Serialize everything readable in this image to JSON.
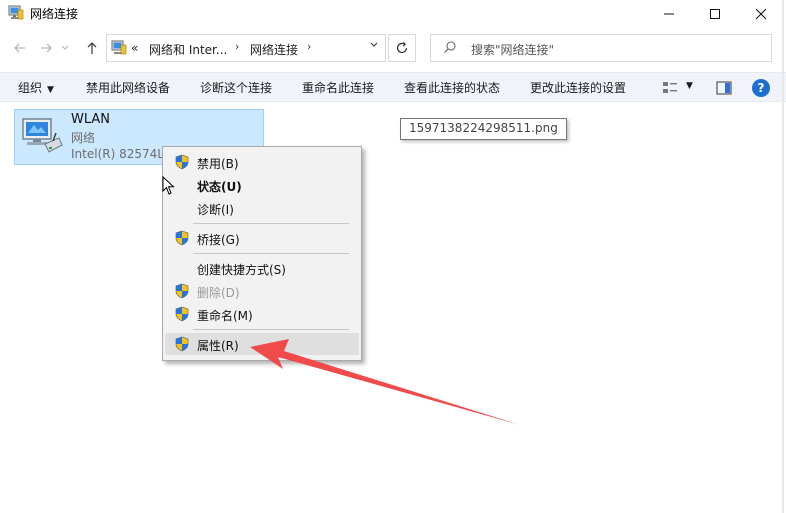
{
  "window": {
    "title": "网络连接",
    "minimize": "—",
    "maximize": "☐",
    "close": "✕"
  },
  "nav": {
    "back_icon": "arrow-left",
    "forward_icon": "arrow-right",
    "dropdown_icon": "chevron-down",
    "up_icon": "arrow-up",
    "breadcrumb_overflow": "«",
    "breadcrumbs": [
      "网络和 Inter...",
      "网络连接"
    ],
    "refresh_icon": "refresh",
    "search_placeholder": "搜索\"网络连接\""
  },
  "commands": {
    "organize": "组织",
    "disable_device": "禁用此网络设备",
    "diagnose": "诊断这个连接",
    "rename": "重命名此连接",
    "view_status": "查看此连接的状态",
    "change_settings": "更改此连接的设置",
    "help": "?"
  },
  "adapter": {
    "name": "WLAN",
    "status": "网络",
    "device": "Intel(R) 82574L"
  },
  "tooltip": "1597138224298511.png",
  "context_menu": {
    "items": [
      {
        "label": "禁用(B)",
        "shield": true
      },
      {
        "label": "状态(U)",
        "shield": false,
        "bold": true
      },
      {
        "label": "诊断(I)",
        "shield": false
      },
      {
        "label": "桥接(G)",
        "shield": true
      },
      {
        "label": "创建快捷方式(S)",
        "shield": false
      },
      {
        "label": "删除(D)",
        "shield": true,
        "disabled": true
      },
      {
        "label": "重命名(M)",
        "shield": true
      },
      {
        "label": "属性(R)",
        "shield": true,
        "highlighted": true
      }
    ]
  },
  "colors": {
    "selection_bg": "#cce8ff",
    "command_bar_bg": "#f0f3f9",
    "annotation_arrow": "#ef4b4b",
    "help_blue": "#1e6fd0"
  }
}
